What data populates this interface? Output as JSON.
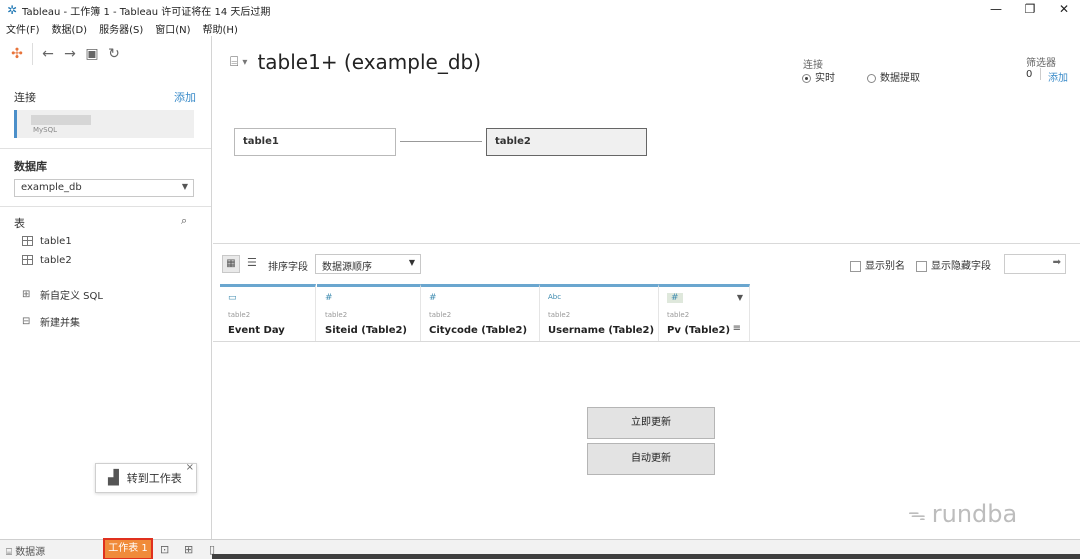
{
  "window": {
    "title": "Tableau - 工作簿 1 - Tableau 许可证将在 14 天后过期",
    "min_icon": "minimize-icon",
    "restore_icon": "restore-icon",
    "close_icon": "close-icon"
  },
  "menu": [
    "文件(F)",
    "数据(D)",
    "服务器(S)",
    "窗口(N)",
    "帮助(H)"
  ],
  "left": {
    "connect_label": "连接",
    "add_label": "添加",
    "connection_type": "MySQL",
    "database_label": "数据库",
    "database_value": "example_db",
    "tables_label": "表",
    "tables": [
      "table1",
      "table2"
    ],
    "new_custom_sql": "新自定义 SQL",
    "new_union": "新建并集",
    "tooltip_text": "转到工作表"
  },
  "main": {
    "title": "table1+ (example_db)",
    "connection_label": "连接",
    "live_label": "实时",
    "extract_label": "数据提取",
    "filter_label": "筛选器",
    "filter_count": "0",
    "filter_add": "添加",
    "nodes": [
      "table1",
      "table2"
    ]
  },
  "grid": {
    "sort_label": "排序字段",
    "sort_value": "数据源顺序",
    "show_alias": "显示别名",
    "show_hidden": "显示隐藏字段",
    "columns": [
      {
        "type_icon": "▭",
        "source": "table2",
        "name": "Event Day"
      },
      {
        "type_icon": "#",
        "source": "table2",
        "name": "Siteid (Table2)"
      },
      {
        "type_icon": "#",
        "source": "table2",
        "name": "Citycode (Table2)"
      },
      {
        "type_icon": "Abc",
        "source": "table2",
        "name": "Username (Table2)"
      },
      {
        "type_icon": "#",
        "source": "table2",
        "name": "Pv (Table2)"
      }
    ],
    "update_now": "立即更新",
    "auto_update": "自动更新"
  },
  "bottom": {
    "datasource_tab": "数据源",
    "worksheet_tab": "工作表 1"
  },
  "watermark": "rundba",
  "colors": {
    "accent": "#3a8bc9",
    "tab_orange": "#f08b3a",
    "tab_border": "#e0301e",
    "column_top": "#6aa6cf"
  }
}
